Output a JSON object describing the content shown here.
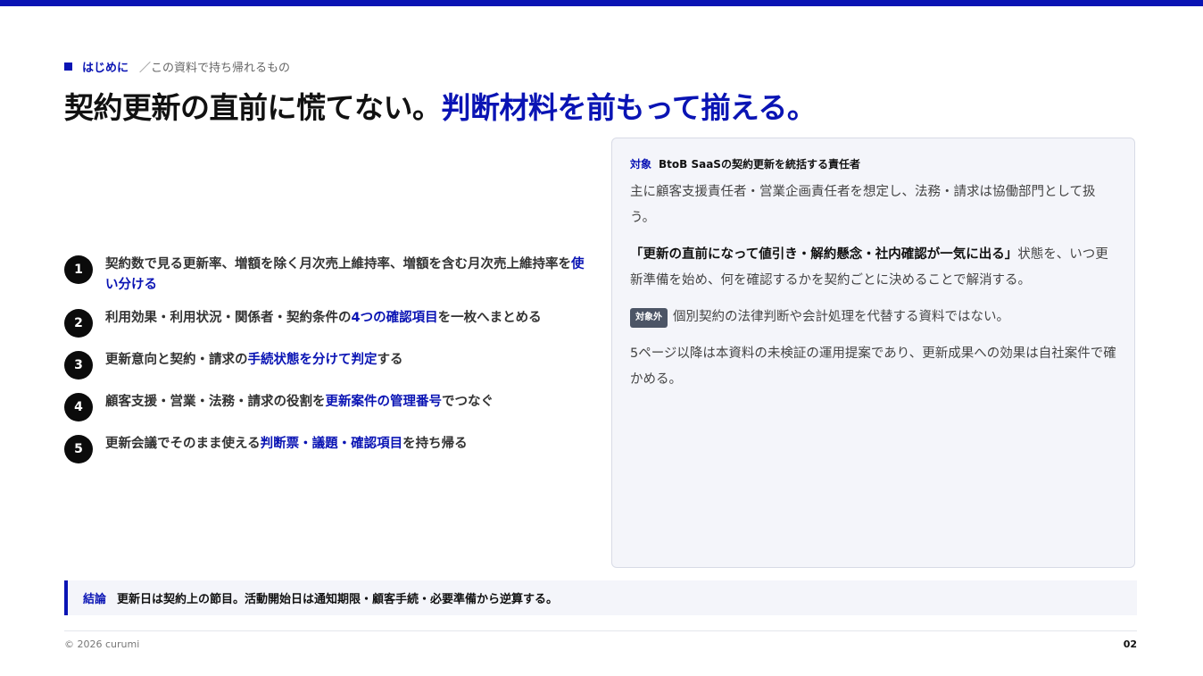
{
  "header": {
    "label": "はじめに",
    "sub": "／この資料で持ち帰れるもの"
  },
  "headline": {
    "part1": "契約更新の直前に慌てない。",
    "part2": "判断材料を前もって揃える。"
  },
  "points": [
    {
      "num": "1",
      "pre": "契約数で見る更新率、増額を除く月次売上維持率、増額を含む月次売上維持率を",
      "em": "使い分ける",
      "post": ""
    },
    {
      "num": "2",
      "pre": "利用効果・利用状況・関係者・契約条件の",
      "em": "4つの確認項目",
      "post": "を一枚へまとめる"
    },
    {
      "num": "3",
      "pre": "更新意向と契約・請求の",
      "em": "手続状態を分けて判定",
      "post": "する"
    },
    {
      "num": "4",
      "pre": "顧客支援・営業・法務・請求の役割を",
      "em": "更新案件の管理番号",
      "post": "でつなぐ"
    },
    {
      "num": "5",
      "pre": "更新会議でそのまま使える",
      "em": "判断票・議題・確認項目",
      "post": "を持ち帰る"
    }
  ],
  "card": {
    "tag": "対象",
    "title": "BtoB SaaSの契約更新を統括する責任者",
    "p1": "主に顧客支援責任者・営業企画責任者を想定し、法務・請求は協働部門として扱う。",
    "p2_strong": "「更新の直前になって値引き・解約懸念・社内確認が一気に出る」",
    "p2_rest": "状態を、いつ更新準備を始め、何を確認するかを契約ごとに決めることで解消する。",
    "badge": "対象外",
    "p3": "個別契約の法律判断や会計処理を代替する資料ではない。",
    "p4": "5ページ以降は本資料の未検証の運用提案であり、更新成果への効果は自社案件で確かめる。"
  },
  "conclusion": {
    "tag": "結論",
    "text": "更新日は契約上の節目。活動開始日は通知期限・顧客手続・必要準備から逆算する。"
  },
  "footer": {
    "copyright": "© 2026 curumi",
    "page": "02"
  },
  "colors": {
    "accent": "#0a14b4",
    "text": "#111111",
    "panel": "#f4f5fa",
    "badge": "#4c5566"
  }
}
